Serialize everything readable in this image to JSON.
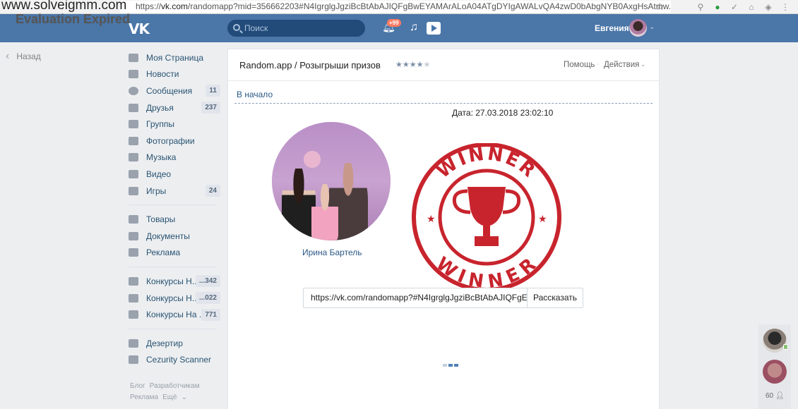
{
  "watermark": {
    "line1": "www.solveigmm.com",
    "line2": "Evaluation Expired"
  },
  "browser": {
    "url_prefix": "https://",
    "url_host": "vk.com",
    "url_path": "/randomapp?mid=356662203#N4IgrglgJgziBcBtAbAJIQFgBwEYAMArALoA04ATgDYIgAWALvQA4zwD0bAbgNYB0AxgHsAtmw..."
  },
  "header": {
    "logo": "VK",
    "search_placeholder": "Поиск",
    "notifications_badge": "+99",
    "user_name": "Евгения"
  },
  "nav": {
    "back_label": "Назад"
  },
  "sidebar": {
    "items": [
      {
        "label": "Моя Страница",
        "count": ""
      },
      {
        "label": "Новости",
        "count": ""
      },
      {
        "label": "Сообщения",
        "count": "11"
      },
      {
        "label": "Друзья",
        "count": "237"
      },
      {
        "label": "Группы",
        "count": ""
      },
      {
        "label": "Фотографии",
        "count": ""
      },
      {
        "label": "Музыка",
        "count": ""
      },
      {
        "label": "Видео",
        "count": ""
      },
      {
        "label": "Игры",
        "count": "24"
      }
    ],
    "items2": [
      {
        "label": "Товары"
      },
      {
        "label": "Документы"
      },
      {
        "label": "Реклама"
      }
    ],
    "groups": [
      {
        "label": "Конкурсы Н...",
        "count": "...342"
      },
      {
        "label": "Конкурсы Н...",
        "count": "...022"
      },
      {
        "label": "Конкурсы На ...",
        "count": "771"
      }
    ],
    "apps": [
      {
        "label": "Дезертир"
      },
      {
        "label": "Cezurity Scanner"
      }
    ],
    "footer": {
      "blog": "Блог",
      "devs": "Разработчикам",
      "ads": "Реклама",
      "more": "Ещё"
    }
  },
  "app": {
    "title": "Random.app / Розыгрыши призов",
    "rating_stars": "★★★★",
    "rating_empty": "★",
    "help": "Помощь",
    "actions": "Действия",
    "back_to_start": "В начало",
    "date_label": "Дата: 27.03.2018 23:02:10",
    "winner_name": "Ирина Бартель",
    "stamp_text": "WINNER",
    "share_url": "https://vk.com/randomapp?#N4IgrglgJgziBcBtAbAJIQFgE",
    "share_button": "Рассказать"
  },
  "chats": {
    "online_count": "60"
  },
  "colors": {
    "vk_blue": "#4a76a8",
    "link": "#2a5885",
    "stamp_red": "#c8242d"
  }
}
